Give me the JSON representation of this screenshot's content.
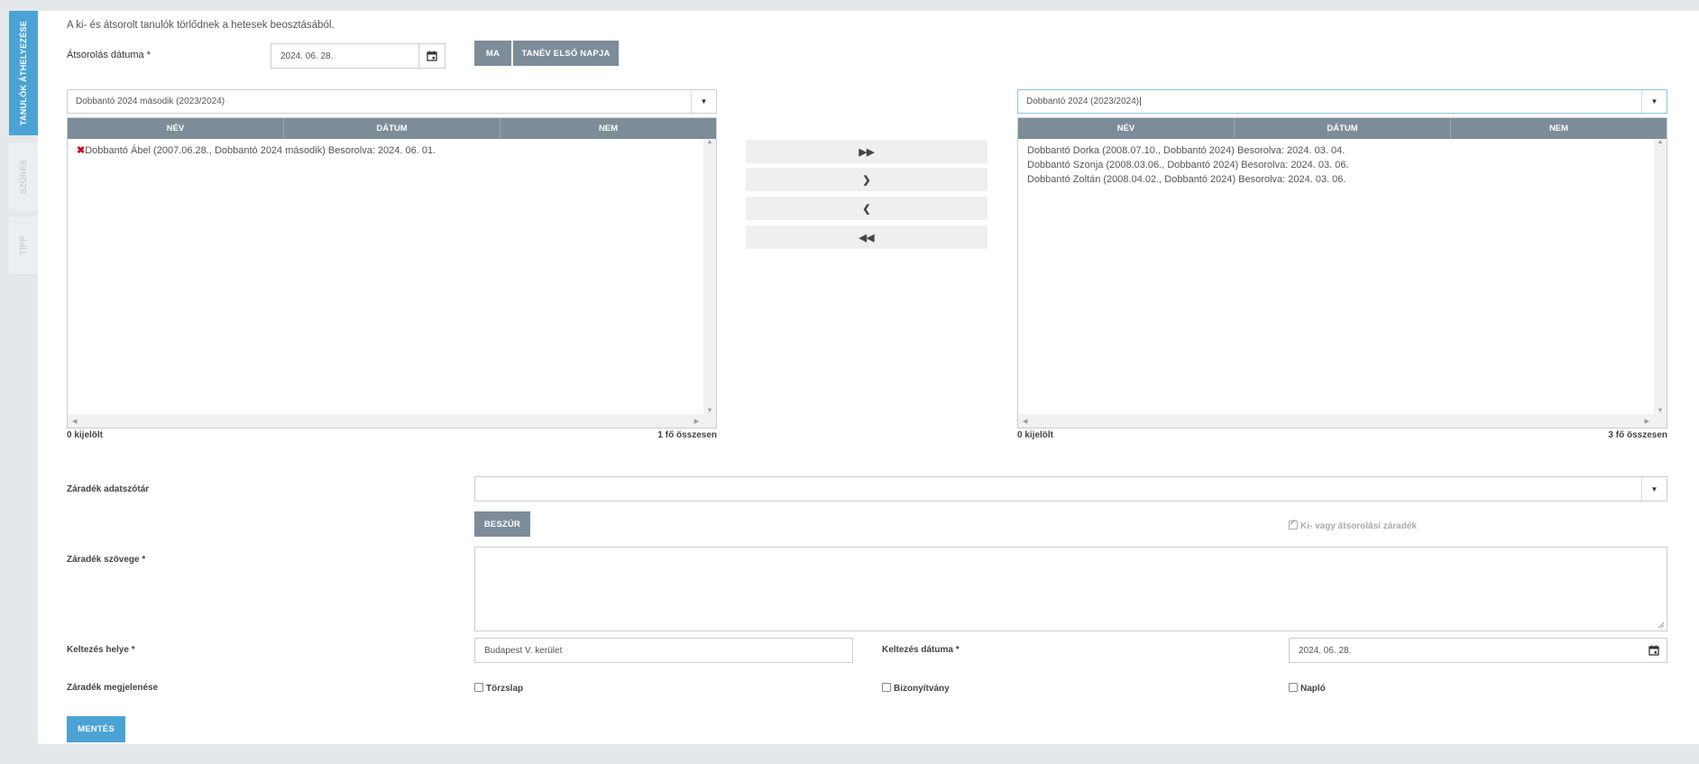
{
  "tabs": [
    {
      "label": "TANULÓK ÁTHELYEZÉSE"
    },
    {
      "label": "SZŰRÉS"
    },
    {
      "label": "TIPP"
    }
  ],
  "info_text": "A ki- és átsorolt tanulók törlődnek a hetesek beosztásából.",
  "date_field": {
    "label": "Átsorolás dátuma *",
    "value": "2024. 06. 28."
  },
  "buttons": {
    "today": "MA",
    "first_day": "TANÉV ELSŐ NAPJA",
    "insert": "BESZÚR",
    "save": "MENTÉS"
  },
  "left_panel": {
    "class_select": "Dobbantó 2024 második (2023/2024)",
    "columns": [
      "NÉV",
      "DÁTUM",
      "NEM"
    ],
    "rows": [
      "Dobbantó Ábel (2007.06.28., Dobbantó 2024 második) Besorolva: 2024. 06. 01."
    ],
    "row_marker": "✖",
    "selected": "0 kijelölt",
    "total": "1 fő összesen"
  },
  "right_panel": {
    "class_select": "Dobbantó 2024 (2023/2024)",
    "columns": [
      "NÉV",
      "DÁTUM",
      "NEM"
    ],
    "rows": [
      "Dobbantó Dorka (2008.07.10., Dobbantó 2024) Besorolva: 2024. 03. 04.",
      "Dobbantó Szonja (2008.03.06., Dobbantó 2024) Besorolva: 2024. 03. 06.",
      "Dobbantó Zoltán (2008.04.02., Dobbantó 2024) Besorolva: 2024. 03. 06."
    ],
    "selected": "0 kijelölt",
    "total": "3 fő összesen"
  },
  "move_buttons": [
    "move-all-right",
    "move-right",
    "move-left",
    "move-all-left"
  ],
  "clause_dictionary": {
    "label": "Záradék adatszótár",
    "value": ""
  },
  "clause_checkbox": {
    "label": "Ki- vagy átsorolási záradék",
    "checked": true
  },
  "clause_text": {
    "label": "Záradék szövege *",
    "value": ""
  },
  "place": {
    "label": "Keltezés helye *",
    "value": "Budapest V. kerület"
  },
  "dated": {
    "label": "Keltezés dátuma *",
    "value": "2024. 06. 28."
  },
  "appearance": {
    "label": "Záradék megjelenése",
    "options": [
      {
        "label": "Törzslap",
        "checked": false
      },
      {
        "label": "Bizonyítvány",
        "checked": false
      },
      {
        "label": "Napló",
        "checked": false
      }
    ]
  }
}
